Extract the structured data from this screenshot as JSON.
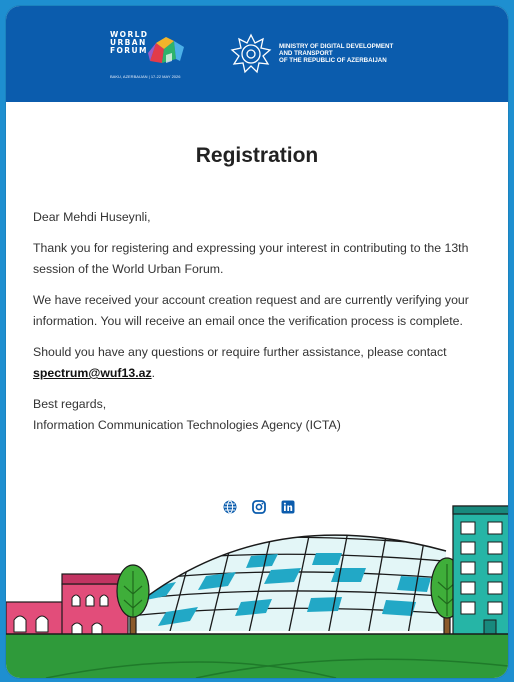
{
  "header": {
    "wuf_logo": {
      "line1": "WORLD",
      "line2": "URBAN",
      "line3": "FORUM",
      "subtitle": "BAKU, AZERBAIJAN | 17-22 MAY 2026"
    },
    "ministry": {
      "line1": "MINISTRY OF DIGITAL DEVELOPMENT",
      "line2": "AND TRANSPORT",
      "line3": "OF THE REPUBLIC OF AZERBAIJAN"
    }
  },
  "email": {
    "title": "Registration",
    "greeting": "Dear Mehdi Huseynli,",
    "para1": "Thank you for registering and expressing your interest in contributing to the 13th session of the World Urban Forum.",
    "para2": "We have received your account creation request and are currently verifying your information. You will receive an email once the verification process is complete.",
    "para3_prefix": "Should you have any questions or require further assistance, please contact",
    "contact_email": "spectrum@wuf13.az",
    "para3_suffix": ".",
    "signoff": "Best regards,",
    "signature": "Information Communication Technologies Agency (ICTA)"
  },
  "social": {
    "icons": [
      "globe-icon",
      "instagram-icon",
      "linkedin-icon"
    ],
    "color": "#0b5cad"
  },
  "colors": {
    "page_background": "#1e8fd0",
    "header_background": "#0b5cad",
    "card_background": "#ffffff"
  }
}
